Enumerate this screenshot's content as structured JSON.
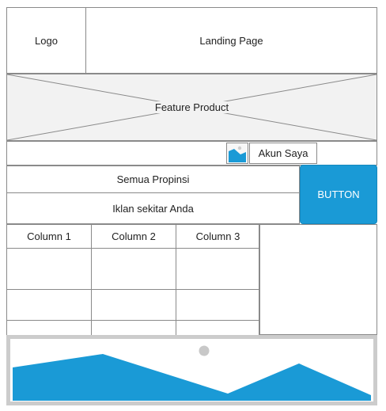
{
  "header": {
    "logo_label": "Logo",
    "title": "Landing Page"
  },
  "feature": {
    "label": "Feature Product"
  },
  "account": {
    "label": "Akun Saya",
    "icon": "image-icon"
  },
  "filters": {
    "province": "Semua Propinsi",
    "nearby_ads": "Iklan sekitar Anda"
  },
  "action_button": {
    "label": "BUTTON",
    "color": "#1a9ad6"
  },
  "table": {
    "columns": [
      "Column 1",
      "Column 2",
      "Column 3"
    ],
    "rows": [
      [
        "",
        "",
        ""
      ],
      [
        "",
        "",
        ""
      ],
      [
        "",
        "",
        ""
      ]
    ]
  },
  "image_placeholder": {
    "icon": "image-placeholder-icon",
    "fill_color": "#1a9ad6"
  }
}
